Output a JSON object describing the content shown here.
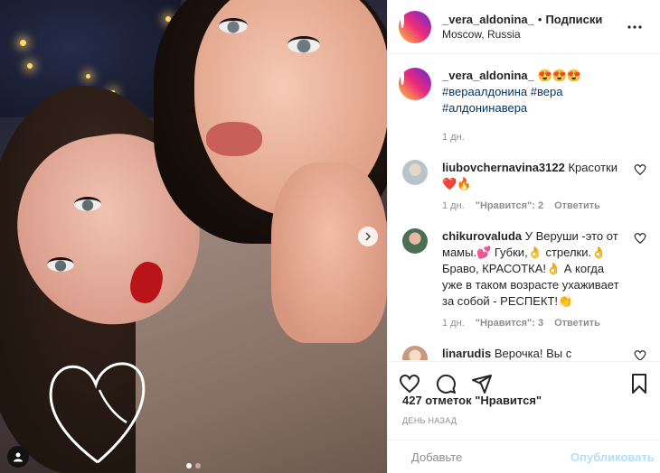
{
  "post": {
    "username": "_vera_aldonina_",
    "separator": "•",
    "follow_label": "Подписки",
    "location": "Moscow, Russia"
  },
  "caption": {
    "username": "_vera_aldonina_",
    "emoji": "😍😍😍",
    "hashtags": [
      "#вераалдонина",
      "#вера",
      "#алдонинавера"
    ],
    "time": "1 дн."
  },
  "comments": [
    {
      "username": "liubovchernavina3122",
      "text": "Красотки ❤️🔥",
      "time": "1 дн.",
      "likes": "\"Нравится\": 2",
      "reply": "Ответить",
      "avatar_color": "#b8c4cc"
    },
    {
      "username": "chikurovaluda",
      "text": "У Веруши -это от мамы.💕 Губки,👌 стрелки.👌 Браво, КРАСОТКА!👌 А когда уже в таком возрасте ухаживает за собой - РЕСПЕКТ!👏",
      "time": "1 дн.",
      "likes": "\"Нравится\": 3",
      "reply": "Ответить",
      "avatar_color": "#4a6f52"
    },
    {
      "username": "linarudis",
      "text": "Верочка! Вы с",
      "avatar_color": "#e6c2a8"
    }
  ],
  "likes_text": "427 отметок \"Нравится\"",
  "time_ago": "ДЕНЬ НАЗАД",
  "add_comment": {
    "placeholder": "Добавьте",
    "publish_label": "Опубликовать"
  },
  "carousel": {
    "count": 2,
    "active": 0
  },
  "colors": {
    "link": "#00376b",
    "muted": "#8e8e8e",
    "publish_disabled": "#b2dffc"
  }
}
